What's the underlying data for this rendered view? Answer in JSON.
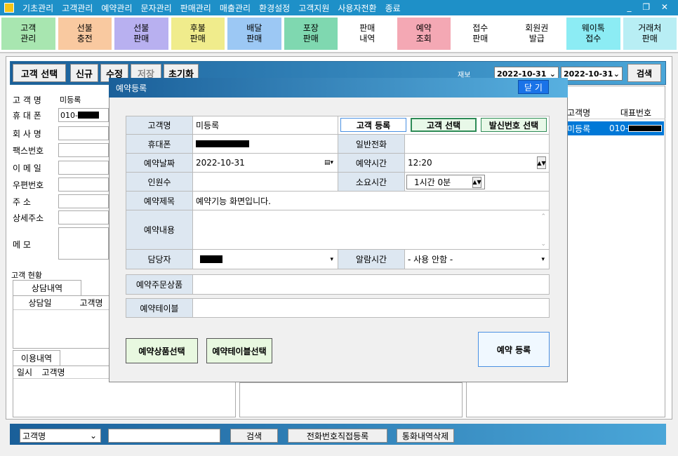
{
  "menu": [
    "기초관리",
    "고객관리",
    "예약관리",
    "문자관리",
    "판매관리",
    "매출관리",
    "환경설정",
    "고객지원",
    "사용자전환",
    "종료"
  ],
  "window_controls": "_ ❐ ✕",
  "toolbar": [
    {
      "label": "고객\n관리",
      "color": "#a8e6b0"
    },
    {
      "label": "선불\n충전",
      "color": "#f9c9a0"
    },
    {
      "label": "선불\n판매",
      "color": "#b8b0f0"
    },
    {
      "label": "후불\n판매",
      "color": "#f0ec8c"
    },
    {
      "label": "배달\n판매",
      "color": "#9cc8f4"
    },
    {
      "label": "포장\n판매",
      "color": "#7fd8b0"
    },
    {
      "label": "판매\n내역",
      "color": "#ffffff"
    },
    {
      "label": "예약\n조회",
      "color": "#f4a8b4"
    },
    {
      "label": "접수\n판매",
      "color": "#ffffff"
    },
    {
      "label": "회원권\n발급",
      "color": "#ffffff"
    },
    {
      "label": "웨이톡\n접수",
      "color": "#8cecf4"
    },
    {
      "label": "거래처\n판매",
      "color": "#b8eef4"
    }
  ],
  "actions": {
    "select": "고객 선택",
    "new": "신규",
    "edit": "수정",
    "save": "저장",
    "reset": "초기화"
  },
  "period_label": "재보",
  "date_from": "2022-10-31",
  "date_to": "2022-10-31",
  "search_btn": "검색",
  "customer_form": {
    "name_label": "고 객 명",
    "name_value": "미등록",
    "phone_label": "휴 대 폰",
    "phone_value": "010-",
    "company_label": "회 사 명",
    "fax_label": "팩스번호",
    "email_label": "이 메 일",
    "zip_label": "우편번호",
    "addr_label": "주    소",
    "addr2_label": "상세주소",
    "memo_label": "메    모"
  },
  "status_title": "고객 현황",
  "tab_consult": "상담내역",
  "consult_cols": [
    "상담일",
    "고객명"
  ],
  "tab_usage": "이용내역",
  "usage_cols": [
    "일시",
    "고객명"
  ],
  "right_list": {
    "cols": [
      "고객명",
      "대표번호"
    ],
    "row": {
      "name": "미등록",
      "phone": "010-"
    }
  },
  "bottom": {
    "select": "고객명",
    "search": "검색",
    "direct": "전화번호직접등록",
    "delete": "통화내역삭제"
  },
  "modal": {
    "title": "예약등록",
    "close": "닫 기",
    "name_label": "고객명",
    "name_value": "미등록",
    "register_btn": "고객 등록",
    "select_btn": "고객 선택",
    "caller_btn": "발신번호 선택",
    "phone_label": "휴대폰",
    "tel_label": "일반전화",
    "date_label": "예약날짜",
    "date_value": "2022-10-31",
    "time_label": "예약시간",
    "time_value": "12:20",
    "people_label": "인원수",
    "duration_label": "소요시간",
    "duration_value": "1시간   0분",
    "subject_label": "예약제목",
    "subject_value": "예약기능 화면입니다.",
    "content_label": "예약내용",
    "staff_label": "담당자",
    "alarm_label": "알람시간",
    "alarm_value": "- 사용 안함 -",
    "order_label": "예약주문상품",
    "table_label": "예약테이블",
    "product_btn": "예약상품선택",
    "table_btn": "예약테이블선택",
    "submit_btn": "예약 등록"
  }
}
